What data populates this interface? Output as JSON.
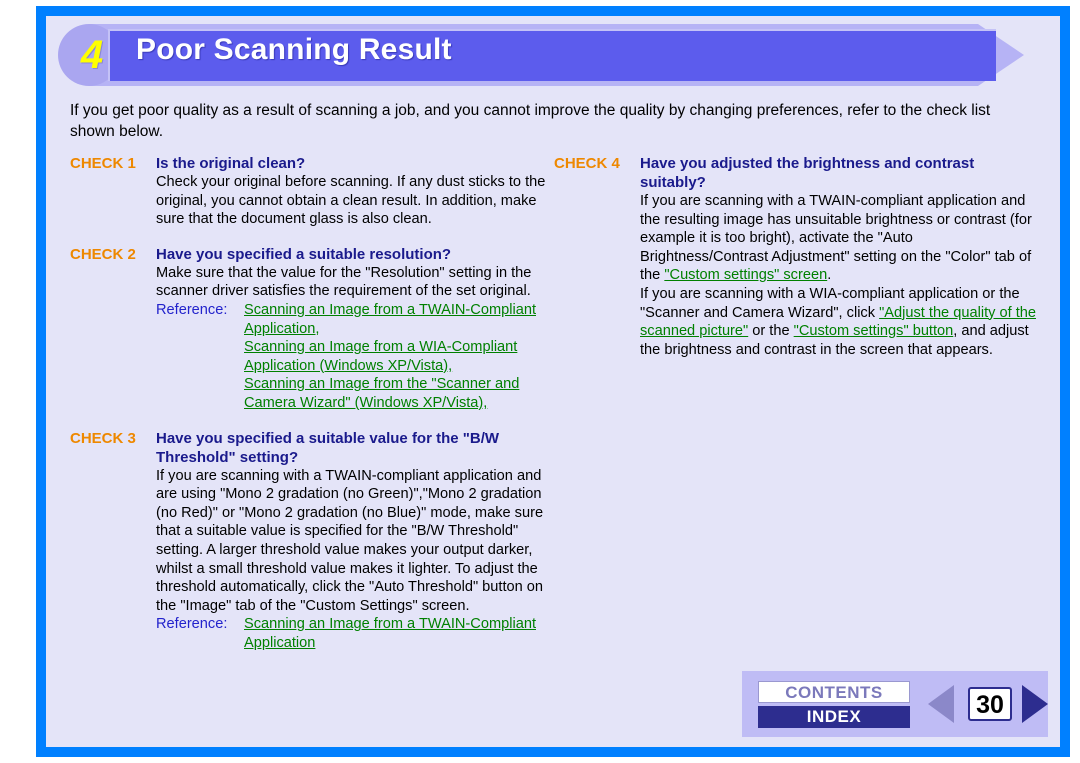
{
  "banner": {
    "number": "4",
    "title": "Poor Scanning Result"
  },
  "intro": "If you get poor quality as a result of scanning a job, and you cannot improve the quality by changing preferences, refer to the check list shown below.",
  "reference_label": "Reference:",
  "checks": {
    "check1": {
      "label": "CHECK 1",
      "question": "Is the original clean?",
      "body": "Check your original before scanning. If any dust sticks to the original, you cannot obtain a clean result. In addition, make sure that the document glass is also clean."
    },
    "check2": {
      "label": "CHECK 2",
      "question": "Have you specified a suitable resolution?",
      "body": "Make sure that the value for the \"Resolution\" setting in the scanner driver satisfies the requirement of the set original.",
      "links": [
        "Scanning an Image from a TWAIN-Compliant Application,",
        "Scanning an Image from a WIA-Compliant Application (Windows XP/Vista),",
        "Scanning an Image from the \"Scanner and Camera Wizard\" (Windows XP/Vista),"
      ]
    },
    "check3": {
      "label": "CHECK 3",
      "question": "Have you specified a suitable value for the \"B/W Threshold\" setting?",
      "body": "If you are scanning with a TWAIN-compliant application and are using \"Mono 2 gradation (no Green)\",\"Mono 2 gradation (no Red)\" or \"Mono 2 gradation (no Blue)\" mode, make sure that a suitable value is specified for the \"B/W Threshold\" setting. A larger threshold value makes your output darker, whilst a small threshold value makes it lighter. To adjust the threshold automatically, click the \"Auto Threshold\" button on the \"Image\" tab of the \"Custom Settings\" screen.",
      "links": [
        "Scanning an Image from a TWAIN-Compliant Application"
      ]
    },
    "check4": {
      "label": "CHECK 4",
      "question": "Have you adjusted the brightness and contrast suitably?",
      "body_part1": "If you are scanning with a TWAIN-compliant application and the resulting image has unsuitable brightness or contrast (for example it is too bright), activate the \"Auto Brightness/Contrast Adjustment\" setting on the \"Color\" tab of the ",
      "inline_link1": "\"Custom settings\" screen",
      "body_part2": ".",
      "body_part3": "If you are scanning with a WIA-compliant application or the \"Scanner and Camera Wizard\", click ",
      "inline_link2": "\"Adjust the quality of the scanned picture\"",
      "body_part4": " or the ",
      "inline_link3": "\"Custom settings\" button",
      "body_part5": ", and adjust the brightness and contrast in the screen that appears."
    }
  },
  "nav": {
    "contents": "CONTENTS",
    "index": "INDEX",
    "page_number": "30",
    "prev_icon": "triangle-left-icon",
    "next_icon": "triangle-right-icon"
  },
  "colors": {
    "frame_blue": "#0080ff",
    "page_bg": "#e4e4f8",
    "banner_bar": "#5c5ced",
    "banner_circle": "#aaa6f0",
    "banner_number": "#ffff00",
    "check_label": "#ee8800",
    "check_question": "#1a1a8c",
    "link_green": "#008000",
    "reference_blue": "#2323cc",
    "nav_bg": "#bfbcf5",
    "nav_navy": "#2d2d8f",
    "nav_prev_disabled": "#8b88c9"
  }
}
